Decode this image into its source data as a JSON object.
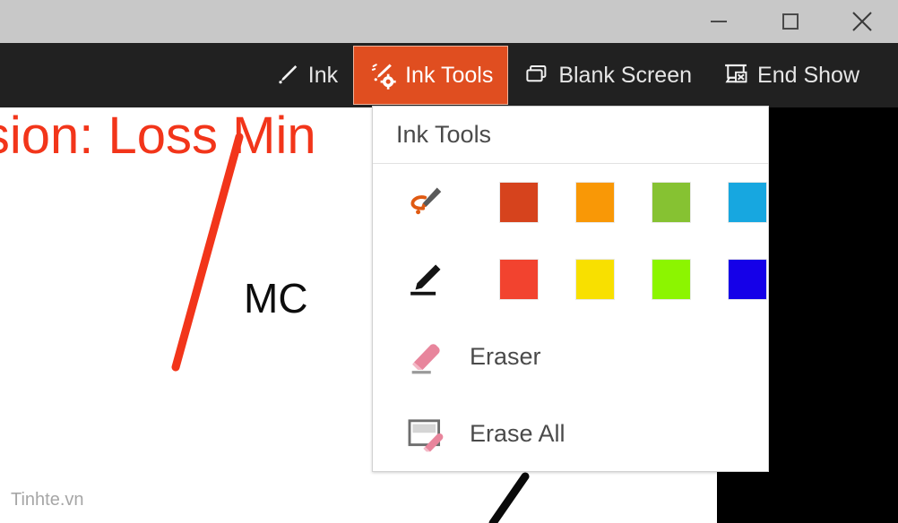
{
  "window": {
    "controls": [
      {
        "name": "minimize",
        "label": "Minimize",
        "glyph": "minimize-icon"
      },
      {
        "name": "maximize",
        "label": "Maximize",
        "glyph": "maximize-icon"
      },
      {
        "name": "close",
        "label": "Close",
        "glyph": "close-icon"
      }
    ]
  },
  "toolbar": {
    "background": "#212121",
    "active_color": "#e04e20",
    "buttons": [
      {
        "id": "ink",
        "label": "Ink",
        "icon": "pen-icon",
        "active": false
      },
      {
        "id": "ink-tools",
        "label": "Ink Tools",
        "icon": "ink-tools-icon",
        "active": true
      },
      {
        "id": "blank-screen",
        "label": "Blank Screen",
        "icon": "blank-screen-icon",
        "active": false
      },
      {
        "id": "end-show",
        "label": "End Show",
        "icon": "end-show-icon",
        "active": false
      }
    ]
  },
  "popup": {
    "title": "Ink Tools",
    "highlighter": {
      "icon": "highlighter-icon",
      "colors": [
        {
          "name": "dark-orange",
          "hex": "#d6431d"
        },
        {
          "name": "orange",
          "hex": "#f99806"
        },
        {
          "name": "green",
          "hex": "#86c232"
        },
        {
          "name": "blue",
          "hex": "#17a7e0"
        }
      ]
    },
    "pen": {
      "icon": "pen-icon",
      "colors": [
        {
          "name": "red",
          "hex": "#f2432f"
        },
        {
          "name": "yellow",
          "hex": "#f8e000"
        },
        {
          "name": "lime",
          "hex": "#8cf500"
        },
        {
          "name": "blue",
          "hex": "#1500e8"
        }
      ]
    },
    "menu_items": [
      {
        "id": "eraser",
        "label": "Eraser",
        "icon": "eraser-icon"
      },
      {
        "id": "erase-all",
        "label": "Erase All",
        "icon": "erase-all-icon"
      }
    ]
  },
  "slide": {
    "title": "cision: Loss Min",
    "title_color": "#f2351a",
    "annotation_label": "MC",
    "watermark": "Tinhte.vn",
    "ink_strokes": [
      {
        "name": "red-stroke",
        "color": "#f2351a",
        "width": 9
      },
      {
        "name": "black-stroke",
        "color": "#0a0a0a",
        "width": 9
      }
    ]
  }
}
